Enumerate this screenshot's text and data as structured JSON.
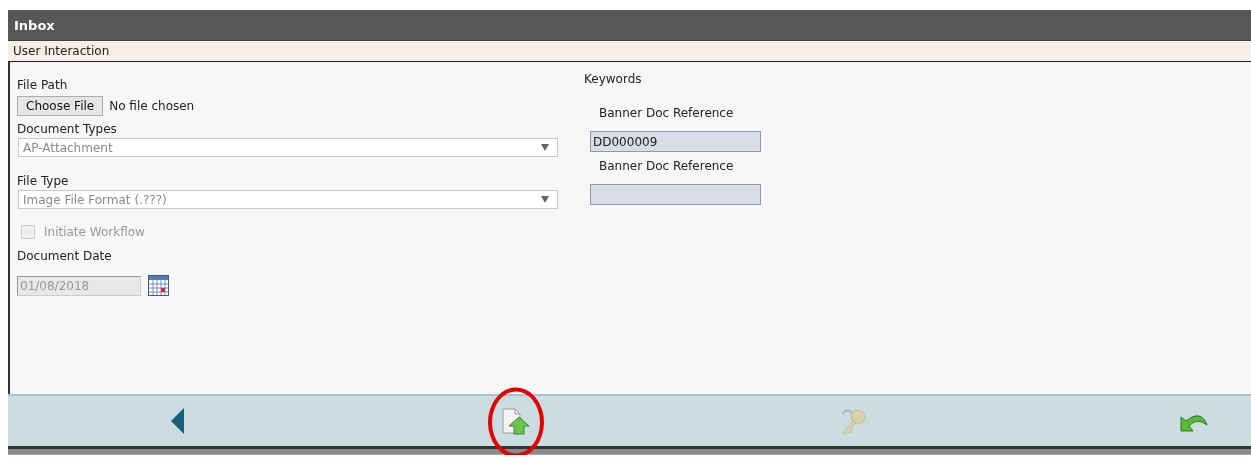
{
  "window": {
    "title": "Inbox"
  },
  "section": {
    "title": "User Interaction"
  },
  "form": {
    "file_path": {
      "label": "File Path",
      "button": "Choose File",
      "status": "No file chosen"
    },
    "document_types": {
      "label": "Document Types",
      "value": "AP-Attachment"
    },
    "file_type": {
      "label": "File Type",
      "value": "Image File Format (.???)"
    },
    "initiate_workflow": {
      "label": "Initiate Workflow",
      "checked": false,
      "disabled": true
    },
    "document_date": {
      "label": "Document Date",
      "value": "01/08/2018",
      "disabled": true
    }
  },
  "keywords": {
    "title": "Keywords",
    "fields": [
      {
        "label": "Banner Doc Reference",
        "value": "DD000009"
      },
      {
        "label": "Banner Doc Reference"
      }
    ]
  },
  "toolbar": {
    "buttons": [
      {
        "kind": "back",
        "disabled": false
      },
      {
        "kind": "upload",
        "disabled": false,
        "highlighted": true
      },
      {
        "kind": "key",
        "disabled": true
      },
      {
        "kind": "undo",
        "disabled": false
      }
    ]
  }
}
